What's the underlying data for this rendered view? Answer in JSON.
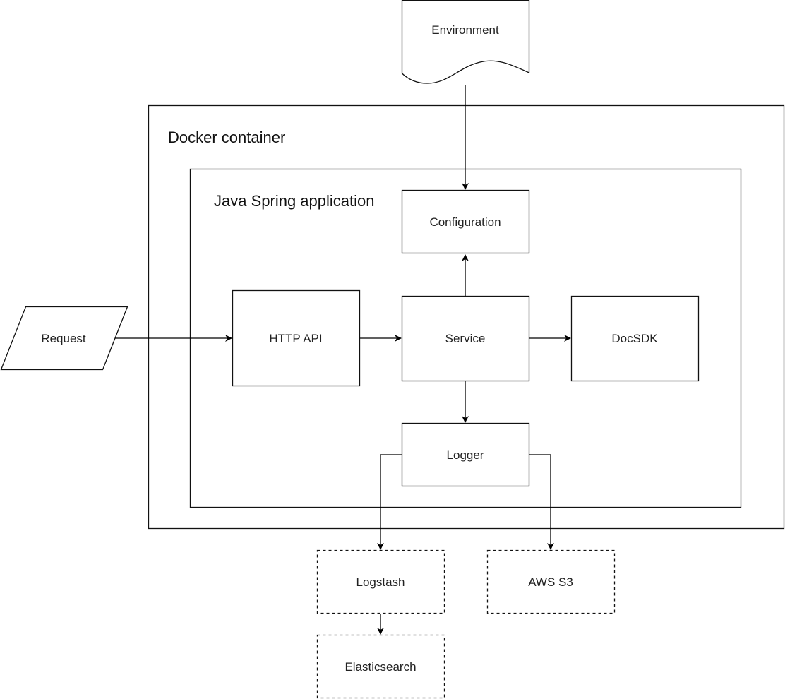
{
  "diagram": {
    "containers": {
      "docker": "Docker container",
      "spring": "Java Spring application"
    },
    "nodes": {
      "environment": "Environment",
      "configuration": "Configuration",
      "request": "Request",
      "http_api": "HTTP API",
      "service": "Service",
      "docsdk": "DocSDK",
      "logger": "Logger",
      "logstash": "Logstash",
      "aws_s3": "AWS S3",
      "elasticsearch": "Elasticsearch"
    },
    "edges": [
      {
        "from": "Environment",
        "to": "Configuration"
      },
      {
        "from": "Request",
        "to": "HTTP API"
      },
      {
        "from": "HTTP API",
        "to": "Service"
      },
      {
        "from": "Service",
        "to": "Configuration"
      },
      {
        "from": "Service",
        "to": "DocSDK"
      },
      {
        "from": "Service",
        "to": "Logger"
      },
      {
        "from": "Logger",
        "to": "Logstash"
      },
      {
        "from": "Logger",
        "to": "AWS S3"
      },
      {
        "from": "Logstash",
        "to": "Elasticsearch"
      }
    ]
  }
}
